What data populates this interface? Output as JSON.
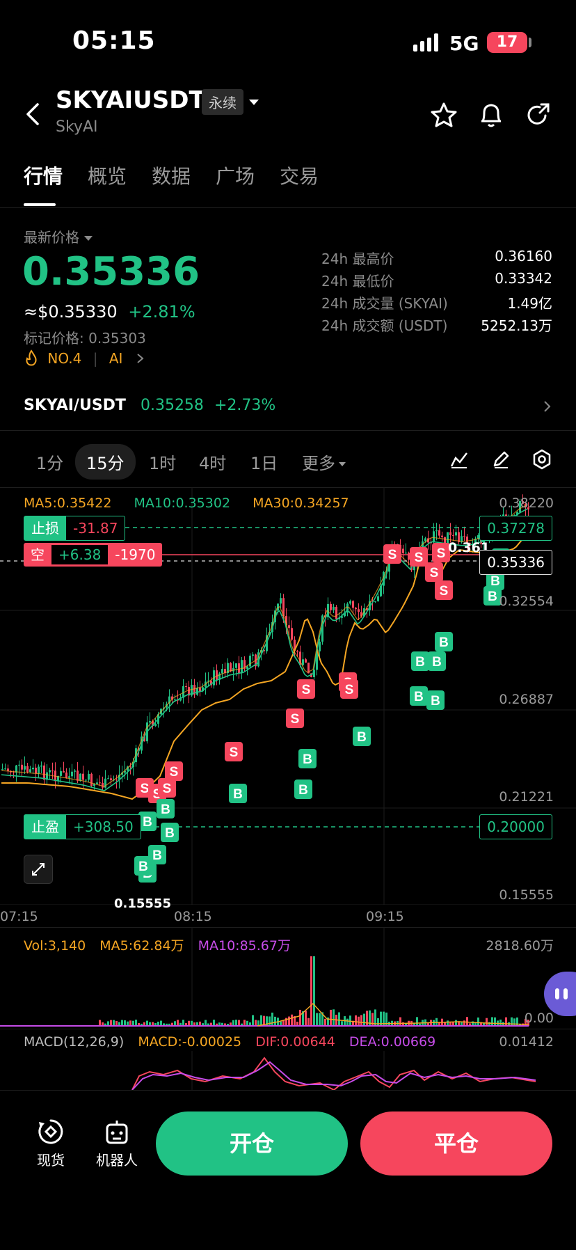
{
  "status": {
    "time": "05:15",
    "network": "5G",
    "battery": "17"
  },
  "header": {
    "pair": "SKYAIUSDT",
    "badge": "永续",
    "subtitle": "SkyAI"
  },
  "tabs": [
    "行情",
    "概览",
    "数据",
    "广场",
    "交易"
  ],
  "price": {
    "label": "最新价格",
    "last": "0.35336",
    "usd": "≈$0.35330",
    "change": "+2.81%",
    "mark": "标记价格: 0.35303",
    "rank": "NO.4",
    "tag": "AI"
  },
  "stats": [
    {
      "label": "24h 最高价",
      "value": "0.36160"
    },
    {
      "label": "24h 最低价",
      "value": "0.33342"
    },
    {
      "label": "24h 成交量 (SKYAI)",
      "value": "1.49亿"
    },
    {
      "label": "24h 成交额 (USDT)",
      "value": "5252.13万"
    }
  ],
  "spot": {
    "pair": "SKYAI/USDT",
    "price": "0.35258",
    "change": "+2.73%"
  },
  "timeframes": [
    "1分",
    "15分",
    "1时",
    "4时",
    "1日",
    "更多"
  ],
  "ma": {
    "ma5": "MA5:0.35422",
    "ma10": "MA10:0.35302",
    "ma30": "MA30:0.34257"
  },
  "price_axis": [
    "0.38220",
    "0.32554",
    "0.26887",
    "0.21221",
    "0.15555"
  ],
  "time_axis": [
    "07:15",
    "08:15",
    "09:15"
  ],
  "order_tags": {
    "stop_loss_label": "止损",
    "stop_loss_value": "-31.87",
    "stop_loss_price": "0.37278",
    "short_label": "空",
    "short_pnl": "+6.38",
    "short_qty": "-1970",
    "take_profit_label": "止盈",
    "take_profit_value": "+308.50",
    "take_profit_price": "0.20000",
    "current_price": "0.35336",
    "high_marker": "0.361",
    "low_marker": "0.15555"
  },
  "volume": {
    "vol": "Vol:3,140",
    "ma5": "MA5:62.84万",
    "ma10": "MA10:85.67万",
    "max": "2818.60万",
    "zero": "0.00"
  },
  "macd": {
    "label": "MACD(12,26,9)",
    "macd": "MACD:-0.00025",
    "dif": "DIF:0.00644",
    "dea": "DEA:0.00669",
    "max": "0.01412"
  },
  "bottom": {
    "spot": "现货",
    "bot": "机器人",
    "open": "开仓",
    "close": "平仓"
  },
  "colors": {
    "up": "#21c285",
    "down": "#f6465d",
    "ma5": "#f5a623",
    "ma10": "#21c285",
    "ma30": "#f5a623"
  }
}
